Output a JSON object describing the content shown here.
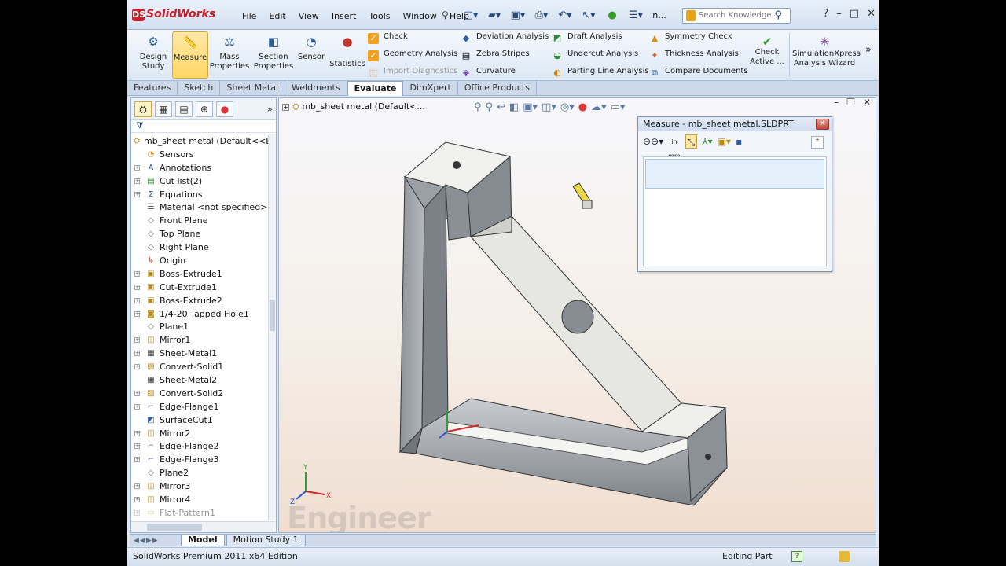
{
  "app": {
    "name": "SolidWorks",
    "menu": [
      "File",
      "Edit",
      "View",
      "Insert",
      "Tools",
      "Window",
      "Help"
    ],
    "menu_more": "n...",
    "search_placeholder": "Search Knowledge",
    "window_buttons": [
      "?",
      "–",
      "□",
      "✕"
    ]
  },
  "command_manager": {
    "large": [
      {
        "id": "design-study",
        "label_1": "Design",
        "label_2": "Study",
        "icon": "design-study-icon"
      },
      {
        "id": "measure",
        "label_1": "Measure",
        "label_2": "",
        "icon": "measure-icon",
        "selected": true
      },
      {
        "id": "mass-properties",
        "label_1": "Mass",
        "label_2": "Properties",
        "icon": "mass-properties-icon"
      },
      {
        "id": "section-properties",
        "label_1": "Section",
        "label_2": "Properties",
        "icon": "section-properties-icon"
      },
      {
        "id": "sensor",
        "label_1": "Sensor",
        "label_2": "",
        "icon": "sensor-icon"
      },
      {
        "id": "statistics",
        "label_1": "Statistics",
        "label_2": "",
        "icon": "statistics-icon"
      }
    ],
    "small": [
      {
        "id": "check",
        "label": "Check",
        "icon": "check-icon"
      },
      {
        "id": "geometry-analysis",
        "label": "Geometry Analysis",
        "icon": "geometry-analysis-icon"
      },
      {
        "id": "import-diagnostics",
        "label": "Import Diagnostics",
        "icon": "import-diagnostics-icon",
        "disabled": true
      },
      {
        "id": "deviation-analysis",
        "label": "Deviation Analysis",
        "icon": "deviation-analysis-icon"
      },
      {
        "id": "zebra-stripes",
        "label": "Zebra Stripes",
        "icon": "zebra-stripes-icon"
      },
      {
        "id": "curvature",
        "label": "Curvature",
        "icon": "curvature-icon"
      },
      {
        "id": "draft-analysis",
        "label": "Draft Analysis",
        "icon": "draft-analysis-icon"
      },
      {
        "id": "undercut-analysis",
        "label": "Undercut Analysis",
        "icon": "undercut-analysis-icon"
      },
      {
        "id": "parting-line-analysis",
        "label": "Parting Line Analysis",
        "icon": "parting-line-analysis-icon"
      },
      {
        "id": "symmetry-check",
        "label": "Symmetry Check",
        "icon": "symmetry-check-icon"
      },
      {
        "id": "thickness-analysis",
        "label": "Thickness Analysis",
        "icon": "thickness-analysis-icon"
      },
      {
        "id": "compare-documents",
        "label": "Compare Documents",
        "icon": "compare-documents-icon"
      }
    ],
    "check_active": {
      "label_1": "Check",
      "label_2": "Active ..."
    },
    "simulation": {
      "label_1": "SimulationXpress",
      "label_2": "Analysis Wizard"
    }
  },
  "tabs": [
    "Features",
    "Sketch",
    "Sheet Metal",
    "Weldments",
    "Evaluate",
    "DimXpert",
    "Office Products"
  ],
  "active_tab": "Evaluate",
  "feature_tree": {
    "root": "mb_sheet metal  (Default<<De",
    "items": [
      {
        "label": "Sensors",
        "icon": "sensors-icon",
        "expand": false
      },
      {
        "label": "Annotations",
        "icon": "annotations-icon",
        "expand": true
      },
      {
        "label": "Cut list(2)",
        "icon": "cut-list-icon",
        "expand": true
      },
      {
        "label": "Equations",
        "icon": "equations-icon",
        "expand": true
      },
      {
        "label": "Material <not specified>",
        "icon": "material-icon",
        "expand": false
      },
      {
        "label": "Front Plane",
        "icon": "plane-icon",
        "expand": false
      },
      {
        "label": "Top Plane",
        "icon": "plane-icon",
        "expand": false
      },
      {
        "label": "Right Plane",
        "icon": "plane-icon",
        "expand": false
      },
      {
        "label": "Origin",
        "icon": "origin-icon",
        "expand": false
      },
      {
        "label": "Boss-Extrude1",
        "icon": "boss-extrude-icon",
        "expand": true
      },
      {
        "label": "Cut-Extrude1",
        "icon": "cut-extrude-icon",
        "expand": true
      },
      {
        "label": "Boss-Extrude2",
        "icon": "boss-extrude-icon",
        "expand": true
      },
      {
        "label": "1/4-20 Tapped Hole1",
        "icon": "hole-icon",
        "expand": true
      },
      {
        "label": "Plane1",
        "icon": "plane-icon",
        "expand": false
      },
      {
        "label": "Mirror1",
        "icon": "mirror-icon",
        "expand": true
      },
      {
        "label": "Sheet-Metal1",
        "icon": "sheet-metal-icon",
        "expand": true
      },
      {
        "label": "Convert-Solid1",
        "icon": "convert-solid-icon",
        "expand": true
      },
      {
        "label": "Sheet-Metal2",
        "icon": "sheet-metal-icon",
        "expand": false
      },
      {
        "label": "Convert-Solid2",
        "icon": "convert-solid-icon",
        "expand": true
      },
      {
        "label": "Edge-Flange1",
        "icon": "edge-flange-icon",
        "expand": true
      },
      {
        "label": "SurfaceCut1",
        "icon": "surface-cut-icon",
        "expand": false
      },
      {
        "label": "Mirror2",
        "icon": "mirror-icon",
        "expand": true
      },
      {
        "label": "Edge-Flange2",
        "icon": "edge-flange-icon",
        "expand": true
      },
      {
        "label": "Edge-Flange3",
        "icon": "edge-flange-icon",
        "expand": true
      },
      {
        "label": "Plane2",
        "icon": "plane-icon",
        "expand": false
      },
      {
        "label": "Mirror3",
        "icon": "mirror-icon",
        "expand": true
      },
      {
        "label": "Mirror4",
        "icon": "mirror-icon",
        "expand": true
      },
      {
        "label": "Flat-Pattern1",
        "icon": "flat-pattern-icon",
        "expand": true
      }
    ]
  },
  "graphics": {
    "doc_label": "mb_sheet metal  (Default<...",
    "watermark": "Engineer"
  },
  "measure_dialog": {
    "title": "Measure - mb_sheet metal.SLDPRT",
    "close": "✕",
    "units_top": "in",
    "units_bottom": "mm"
  },
  "bottom_tabs": [
    "Model",
    "Motion Study 1"
  ],
  "active_bottom_tab": "Model",
  "status": {
    "left": "SolidWorks Premium 2011 x64 Edition",
    "right": "Editing Part",
    "help": "?"
  },
  "colors": {
    "accent": "#c8202c",
    "selection": "#ffd765",
    "part": "#a9adb3"
  }
}
